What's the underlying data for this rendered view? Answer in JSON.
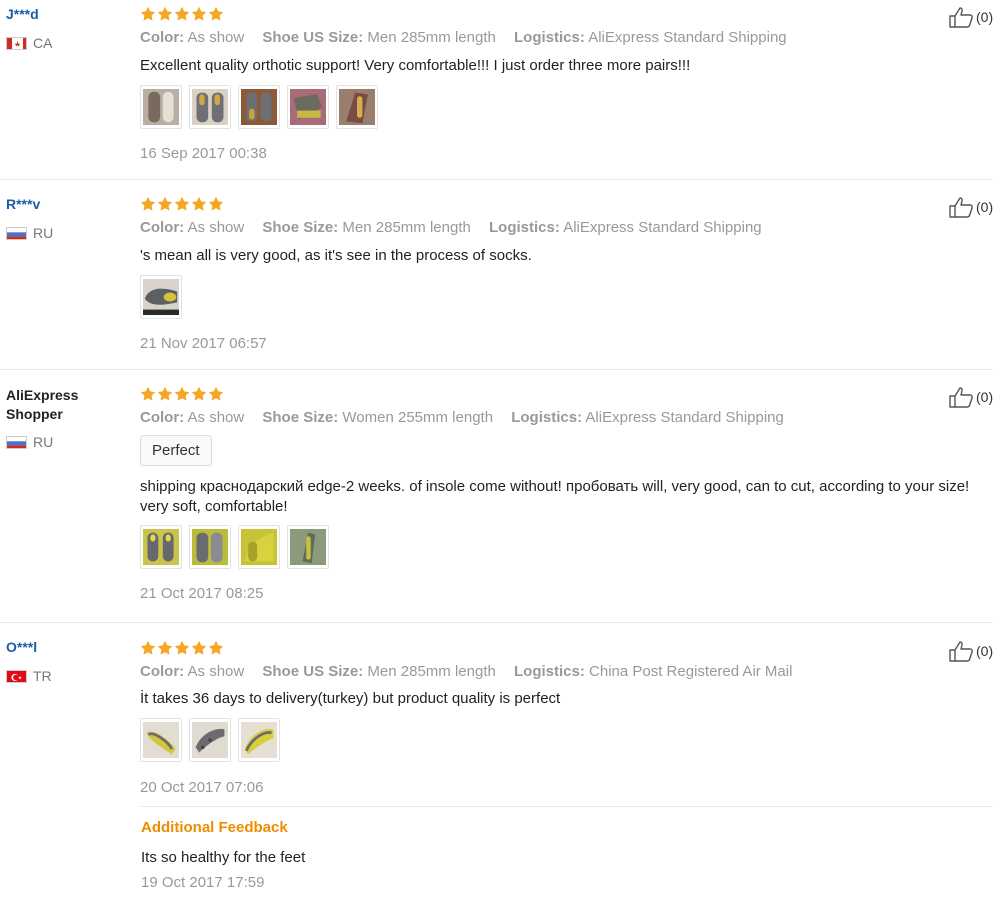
{
  "labels": {
    "color": "Color:",
    "shoe_us_size": "Shoe US Size:",
    "shoe_size": "Shoe Size:",
    "logistics": "Logistics:",
    "additional_feedback": "Additional Feedback"
  },
  "colors": {
    "star": "#f5a623",
    "link": "#1a5ea8",
    "accent": "#f08c00",
    "muted": "#999999"
  },
  "reviews": [
    {
      "user": "J***d",
      "country": "CA",
      "flag": "canada-flag-icon",
      "rating": 5,
      "color": "As show",
      "size_label": "Shoe US Size:",
      "size": "Men 285mm length",
      "logistics": "AliExpress Standard Shipping",
      "text": "Excellent quality orthotic support! Very comfortable!!! I just order three more pairs!!!",
      "photos": 5,
      "date": "16 Sep 2017 00:38",
      "helpful": "(0)"
    },
    {
      "user": "R***v",
      "country": "RU",
      "flag": "russia-flag-icon",
      "rating": 5,
      "color": "As show",
      "size_label": "Shoe Size:",
      "size": "Men 285mm length",
      "logistics": "AliExpress Standard Shipping",
      "text": "'s mean all is very good, as it's see in the process of socks.",
      "photos": 1,
      "date": "21 Nov 2017 06:57",
      "helpful": "(0)"
    },
    {
      "user": "AliExpress Shopper",
      "country": "RU",
      "flag": "russia-flag-icon",
      "rating": 5,
      "color": "As show",
      "size_label": "Shoe Size:",
      "size": "Women 255mm length",
      "logistics": "AliExpress Standard Shipping",
      "tag": "Perfect",
      "text": "shipping краснодарский edge-2 weeks. of insole come without! пробовать will, very good, can to cut, according to your size! very soft, comfortable!",
      "photos": 4,
      "date": "21 Oct 2017 08:25",
      "helpful": "(0)"
    },
    {
      "user": "O***l",
      "country": "TR",
      "flag": "turkey-flag-icon",
      "rating": 5,
      "color": "As show",
      "size_label": "Shoe US Size:",
      "size": "Men 285mm length",
      "logistics": "China Post Registered Air Mail",
      "text": "İt takes 36 days to delivery(turkey) but product quality is perfect",
      "photos": 3,
      "date": "20 Oct 2017 07:06",
      "helpful": "(0)",
      "additional_text": "Its so healthy for the feet",
      "additional_date": "19 Oct 2017 17:59"
    }
  ]
}
